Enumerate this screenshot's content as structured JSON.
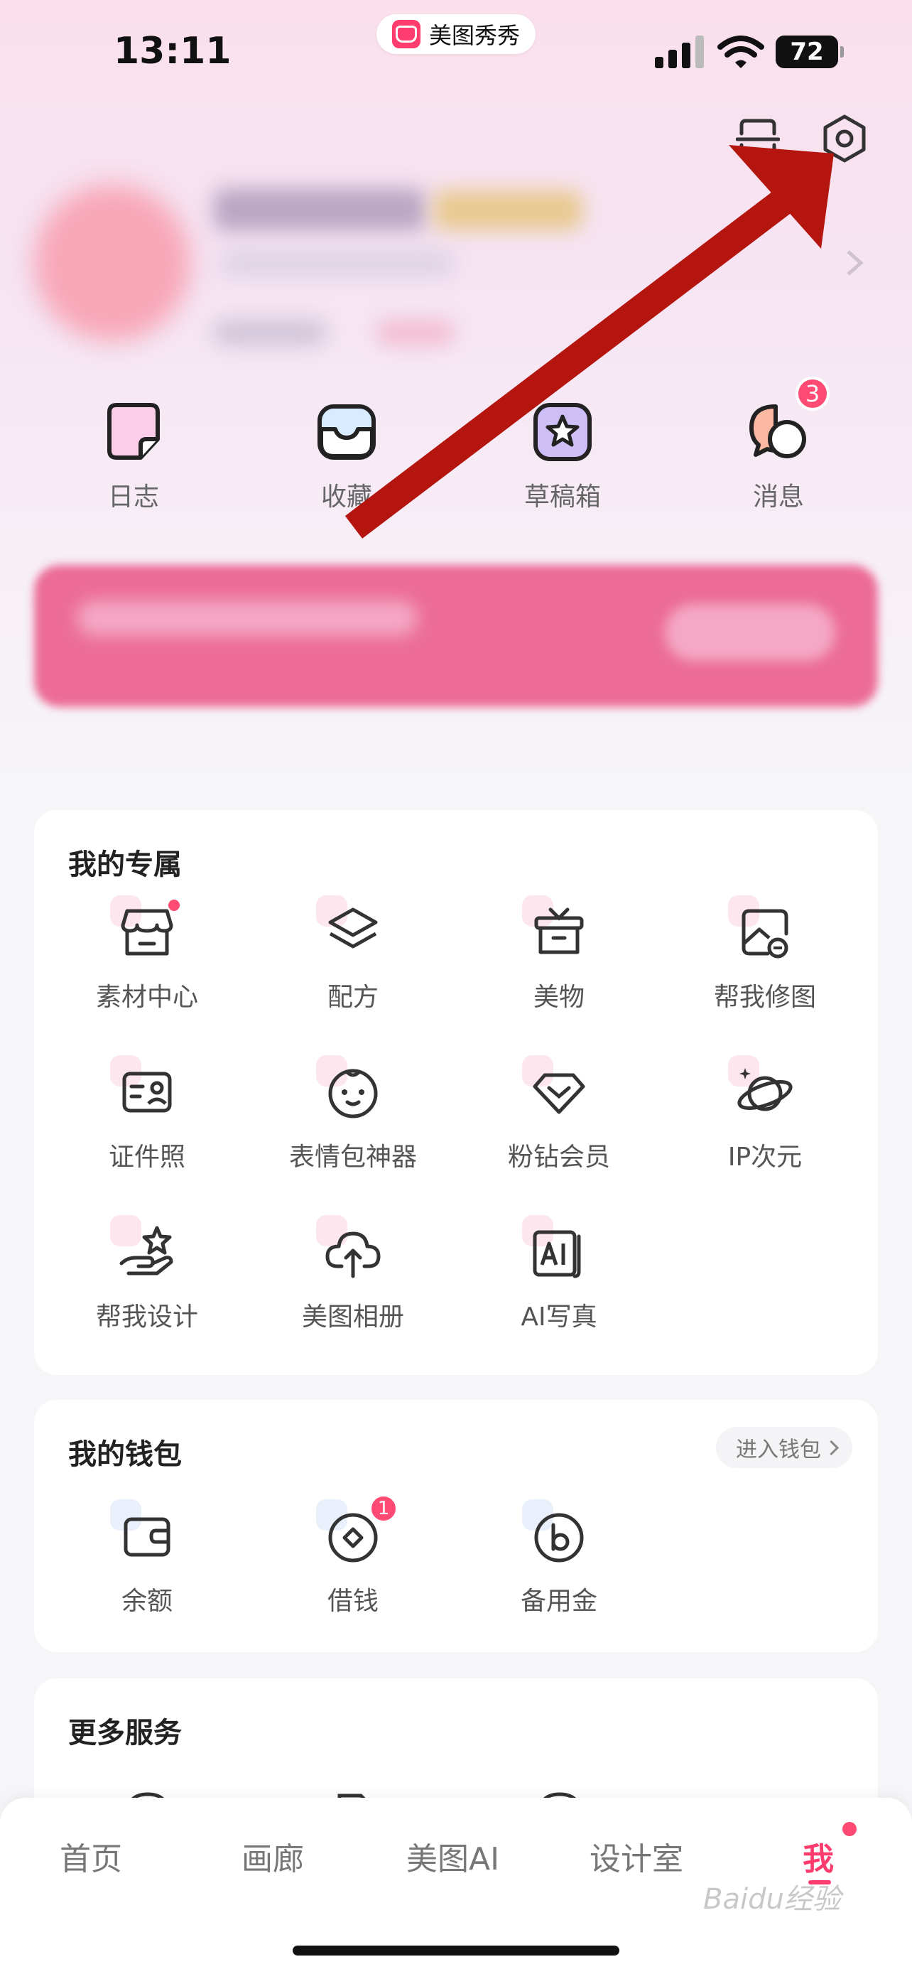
{
  "status_bar": {
    "time": "13:11",
    "app_name": "美图秀秀",
    "battery": "72"
  },
  "quick_actions": [
    {
      "label": "日志",
      "icon": "diary-icon"
    },
    {
      "label": "收藏",
      "icon": "favorites-icon"
    },
    {
      "label": "草稿箱",
      "icon": "drafts-icon"
    },
    {
      "label": "消息",
      "icon": "messages-icon",
      "badge": "3"
    }
  ],
  "exclusive": {
    "title": "我的专属",
    "items": [
      {
        "label": "素材中心",
        "icon": "store-icon"
      },
      {
        "label": "配方",
        "icon": "layers-icon"
      },
      {
        "label": "美物",
        "icon": "gift-box-icon"
      },
      {
        "label": "帮我修图",
        "icon": "image-edit-icon"
      },
      {
        "label": "证件照",
        "icon": "id-photo-icon"
      },
      {
        "label": "表情包神器",
        "icon": "baby-face-icon"
      },
      {
        "label": "粉钻会员",
        "icon": "diamond-icon"
      },
      {
        "label": "IP次元",
        "icon": "planet-icon"
      },
      {
        "label": "帮我设计",
        "icon": "hand-star-icon"
      },
      {
        "label": "美图相册",
        "icon": "cloud-upload-icon"
      },
      {
        "label": "AI写真",
        "icon": "ai-photo-icon"
      }
    ]
  },
  "wallet": {
    "title": "我的钱包",
    "link": "进入钱包",
    "items": [
      {
        "label": "余额",
        "icon": "wallet-icon"
      },
      {
        "label": "借钱",
        "icon": "loan-icon",
        "badge": "1"
      },
      {
        "label": "备用金",
        "icon": "reserve-fund-icon"
      }
    ]
  },
  "more_services": {
    "title": "更多服务"
  },
  "tabs": [
    {
      "label": "首页"
    },
    {
      "label": "画廊"
    },
    {
      "label": "美图AI"
    },
    {
      "label": "设计室"
    },
    {
      "label": "我"
    }
  ],
  "watermark": "Baidu经验",
  "colors": {
    "accent": "#ff3c6e",
    "arrow": "#b5150f",
    "vip": "#ec6c97"
  }
}
